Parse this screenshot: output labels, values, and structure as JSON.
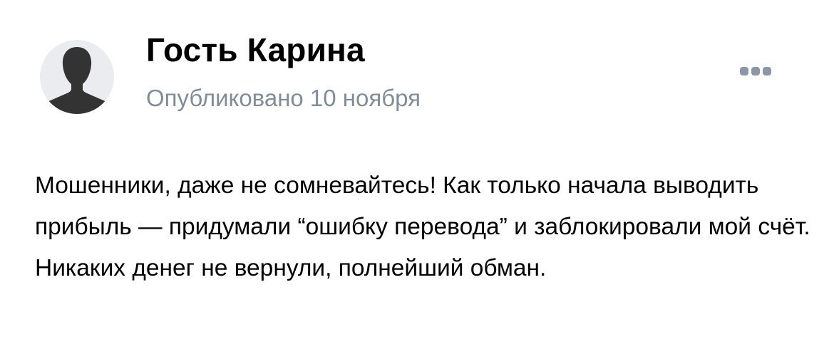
{
  "post": {
    "author": {
      "name": "Гость Карина"
    },
    "date": "Опубликовано 10 ноября",
    "menu_icon": "more-horizontal-icon",
    "text": "Мошенники, даже не сомневайтесь! Как только начала выводить прибыль — придумали “ошибку перевода” и заблокировали мой счёт. Никаких денег не вернули, полнейший обман."
  },
  "colors": {
    "avatar_bg": "#eaecf0",
    "avatar_silhouette": "#333333",
    "secondary_text": "#818c99",
    "menu_icon": "#8a97a8"
  }
}
